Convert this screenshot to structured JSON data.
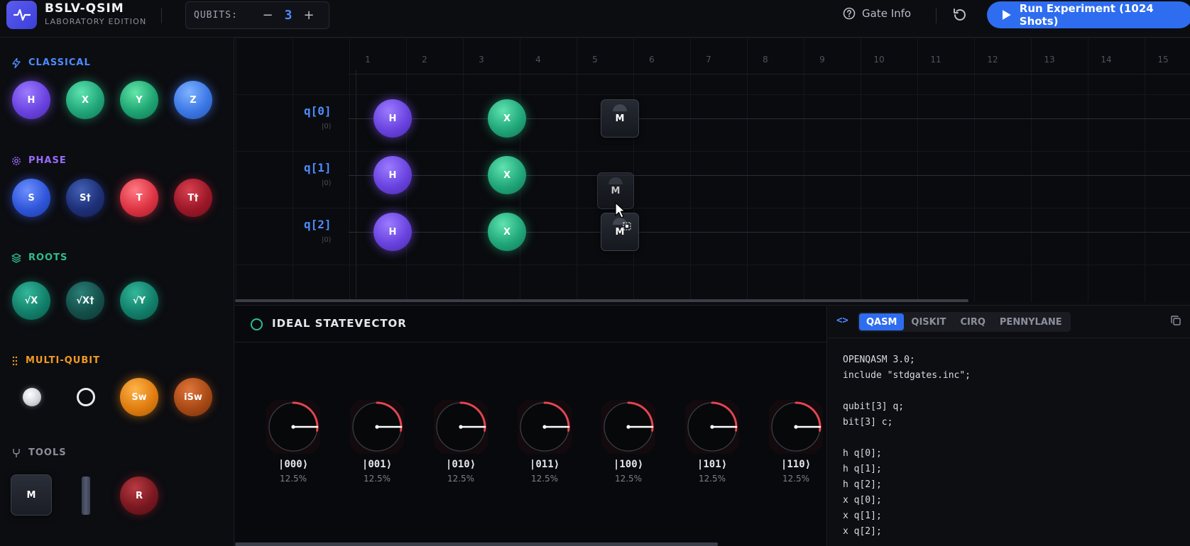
{
  "header": {
    "brand_title": "BSLV-QSIM",
    "brand_subtitle": "LABORATORY EDITION",
    "qubits_label": "QUBITS:",
    "qubits_value": "3",
    "minus": "−",
    "plus": "+",
    "gate_info_label": "Gate Info",
    "run_label": "Run Experiment (1024 Shots)"
  },
  "sidebar": {
    "categories": [
      {
        "label": "CLASSICAL",
        "color": "#4d8cff",
        "gates": [
          "H",
          "X",
          "Y",
          "Z"
        ]
      },
      {
        "label": "PHASE",
        "color": "#9a6cff",
        "gates": [
          "S",
          "S†",
          "T",
          "T†"
        ]
      },
      {
        "label": "ROOTS",
        "color": "#2fbd8a",
        "gates": [
          "√X",
          "√X†",
          "√Y"
        ]
      },
      {
        "label": "MULTI-QUBIT",
        "color": "#f29a24",
        "gates": [
          "Sw",
          "iSw"
        ]
      },
      {
        "label": "TOOLS",
        "color": "#8c909c",
        "gates": [
          "M",
          "R"
        ]
      }
    ]
  },
  "circuit": {
    "columns": [
      "1",
      "2",
      "3",
      "4",
      "5",
      "6",
      "7",
      "8",
      "9",
      "10",
      "11",
      "12",
      "13",
      "14",
      "15"
    ],
    "wires": [
      {
        "label": "q[0]",
        "init": "|0⟩"
      },
      {
        "label": "q[1]",
        "init": "|0⟩"
      },
      {
        "label": "q[2]",
        "init": "|0⟩"
      }
    ],
    "gates": [
      {
        "wire": 0,
        "col": 1,
        "label": "H"
      },
      {
        "wire": 0,
        "col": 3,
        "label": "X"
      },
      {
        "wire": 0,
        "col": 5,
        "label": "M"
      },
      {
        "wire": 1,
        "col": 1,
        "label": "H"
      },
      {
        "wire": 1,
        "col": 3,
        "label": "X"
      },
      {
        "wire": 1,
        "col": 5,
        "label": "M"
      },
      {
        "wire": 2,
        "col": 1,
        "label": "H"
      },
      {
        "wire": 2,
        "col": 3,
        "label": "X"
      },
      {
        "wire": 2,
        "col": 5,
        "label": "M"
      }
    ]
  },
  "statevector": {
    "title": "IDEAL STATEVECTOR",
    "states": [
      {
        "label": "|000⟩",
        "prob": "12.5%"
      },
      {
        "label": "|001⟩",
        "prob": "12.5%"
      },
      {
        "label": "|010⟩",
        "prob": "12.5%"
      },
      {
        "label": "|011⟩",
        "prob": "12.5%"
      },
      {
        "label": "|100⟩",
        "prob": "12.5%"
      },
      {
        "label": "|101⟩",
        "prob": "12.5%"
      },
      {
        "label": "|110⟩",
        "prob": "12.5%"
      }
    ]
  },
  "code": {
    "tabs": [
      "QASM",
      "QISKIT",
      "CIRQ",
      "PENNYLANE"
    ],
    "active_tab": "QASM",
    "lines": [
      "OPENQASM 3.0;",
      "include \"stdgates.inc\";",
      "",
      "qubit[3] q;",
      "bit[3] c;",
      "",
      "h q[0];",
      "h q[1];",
      "h q[2];",
      "x q[0];",
      "x q[1];",
      "x q[2];"
    ]
  }
}
